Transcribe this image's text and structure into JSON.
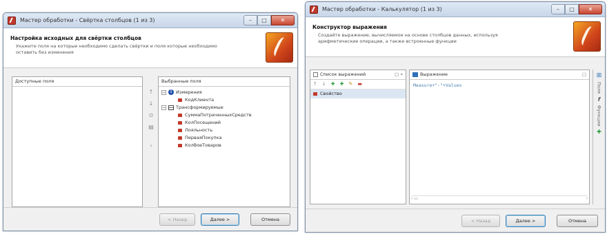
{
  "window_a": {
    "title": "Мастер обработки - Свёртка столбцов (1 из 3)",
    "controls": {
      "minimize": "–",
      "maximize": "□",
      "close": "✕"
    },
    "header": {
      "title": "Настройка исходных для свёртки столбцов",
      "description": "Укажите поля на которые необходимо сделать свёртки и поля которые необходимо оставить без изменения"
    },
    "available_fields": {
      "label": "Доступные поля"
    },
    "selected_fields": {
      "label": "Выбранные поля",
      "groups": [
        {
          "name": "Измерения",
          "items": [
            "КодКлиента"
          ]
        },
        {
          "name": "Трансформируемые",
          "items": [
            "СуммаПотраченныхСредств",
            "КолПосещений",
            "Лояльность",
            "ПерваяПокупка",
            "КолВоеТоваров"
          ]
        }
      ]
    },
    "side_tools": [
      "↑",
      "↓",
      "⊙",
      "▤",
      "‹"
    ],
    "footer": {
      "back": "< Назад",
      "next": "Далее >",
      "cancel": "Отмена"
    }
  },
  "window_b": {
    "title": "Мастер обработки - Калькулятор (1 из 3)",
    "controls": {
      "minimize": "–",
      "maximize": "□",
      "close": "✕"
    },
    "header": {
      "title": "Конструктор выражения",
      "description": "Создайте выражение, вычисляемое на основе столбцов данных, используя арифметические операции, а также встроенные функции"
    },
    "expressions_panel": {
      "label": "Список выражений",
      "toolbar": [
        "↑",
        "↓",
        "✚",
        "✚",
        "✎",
        "▬"
      ],
      "items": [
        "Свойство"
      ]
    },
    "expression_panel": {
      "label": "Выражение",
      "code": "Measure+\"-\"+Values"
    },
    "side_tabs": [
      "Поля",
      "Функции"
    ],
    "footer": {
      "back": "< Назад",
      "next": "Далее >",
      "cancel": "Отмена"
    }
  }
}
